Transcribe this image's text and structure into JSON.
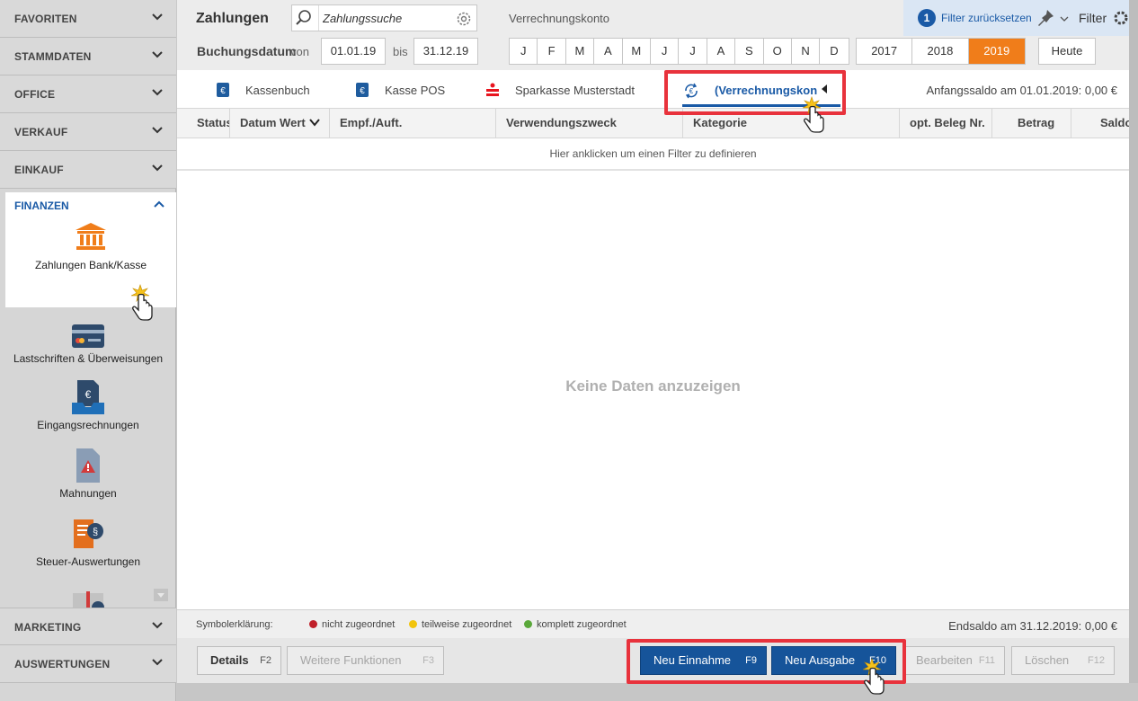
{
  "sidebar": {
    "sections": {
      "favoriten": "FAVORITEN",
      "stammdaten": "STAMMDATEN",
      "office": "OFFICE",
      "verkauf": "VERKAUF",
      "einkauf": "EINKAUF",
      "finanzen": "FINANZEN",
      "marketing": "MARKETING",
      "auswertungen": "AUSWERTUNGEN"
    },
    "finanzen_items": {
      "zahlungen": "Zahlungen Bank/Kasse",
      "lastschriften": "Lastschriften & Überweisungen",
      "eingangsrechnungen": "Eingangsrechnungen",
      "mahnungen": "Mahnungen",
      "steuer": "Steuer-Auswertungen"
    }
  },
  "toolbar": {
    "title": "Zahlungen",
    "search_value": "Zahlungssuche",
    "account_label": "Verrechnungskonto",
    "filter_count": "1",
    "filter_reset": "Filter zurücksetzen",
    "filter_label": "Filter",
    "date_label": "Buchungsdatum",
    "from_label": "von",
    "from_value": "01.01.19",
    "to_label": "bis",
    "to_value": "31.12.19",
    "months": [
      "J",
      "F",
      "M",
      "A",
      "M",
      "J",
      "J",
      "A",
      "S",
      "O",
      "N",
      "D"
    ],
    "years": [
      "2017",
      "2018",
      "2019"
    ],
    "active_year": "2019",
    "today": "Heute"
  },
  "tabs": {
    "kassenbuch": "Kassenbuch",
    "kasse_pos": "Kasse POS",
    "sparkasse": "Sparkasse Musterstadt",
    "verrechnung": "(Verrechnungskon",
    "opening_balance": "Anfangssaldo am 01.01.2019: 0,00 €"
  },
  "grid": {
    "columns": {
      "status": "Status",
      "datum": "Datum Wert",
      "empf": "Empf./Auft.",
      "zweck": "Verwendungszweck",
      "kategorie": "Kategorie",
      "beleg": "opt. Beleg Nr.",
      "betrag": "Betrag",
      "saldo": "Saldo"
    },
    "filter_hint": "Hier anklicken um einen Filter zu definieren",
    "empty": "Keine Daten anzuzeigen"
  },
  "legend": {
    "title": "Symbolerklärung:",
    "items": {
      "none": "nicht zugeordnet",
      "partial": "teilweise zugeordnet",
      "full": "komplett zugeordnet"
    },
    "end_balance": "Endsaldo am 31.12.2019: 0,00 €"
  },
  "actions": {
    "details": "Details",
    "details_key": "F2",
    "weitere": "Weitere Funktionen",
    "weitere_key": "F3",
    "einnahme": "Neu Einnahme",
    "einnahme_key": "F9",
    "ausgabe": "Neu Ausgabe",
    "ausgabe_key": "F10",
    "bearbeiten": "Bearbeiten",
    "bearbeiten_key": "F11",
    "loeschen": "Löschen",
    "loeschen_key": "F12"
  },
  "colors": {
    "accent_blue": "#1a5aa6",
    "active_year": "#f07d1a",
    "highlight": "#e8323c",
    "status_none": "#c0202a",
    "status_partial": "#f2c40c",
    "status_full": "#5aa83a"
  }
}
